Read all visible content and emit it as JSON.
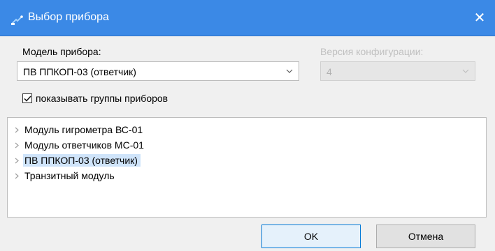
{
  "window": {
    "title": "Выбор прибора",
    "close_glyph": "✕",
    "icon": "device-icon"
  },
  "model": {
    "label": "Модель прибора:",
    "selected": "ПВ ППКОП-03 (ответчик)"
  },
  "config_version": {
    "label": "Версия конфигурации:",
    "selected": "4",
    "enabled": false
  },
  "show_groups": {
    "label": "показывать группы приборов",
    "checked": true
  },
  "tree": {
    "items": [
      {
        "label": "Модуль гигрометра ВС-01",
        "selected": false
      },
      {
        "label": "Модуль ответчиков МС-01",
        "selected": false
      },
      {
        "label": "ПВ ППКОП-03 (ответчик)",
        "selected": true
      },
      {
        "label": "Транзитный модуль",
        "selected": false
      }
    ]
  },
  "buttons": {
    "ok": "OK",
    "cancel": "Отмена"
  },
  "colors": {
    "titlebar": "#3b89e6",
    "selection": "#cfe4fa",
    "default_button_border": "#0078d7"
  }
}
